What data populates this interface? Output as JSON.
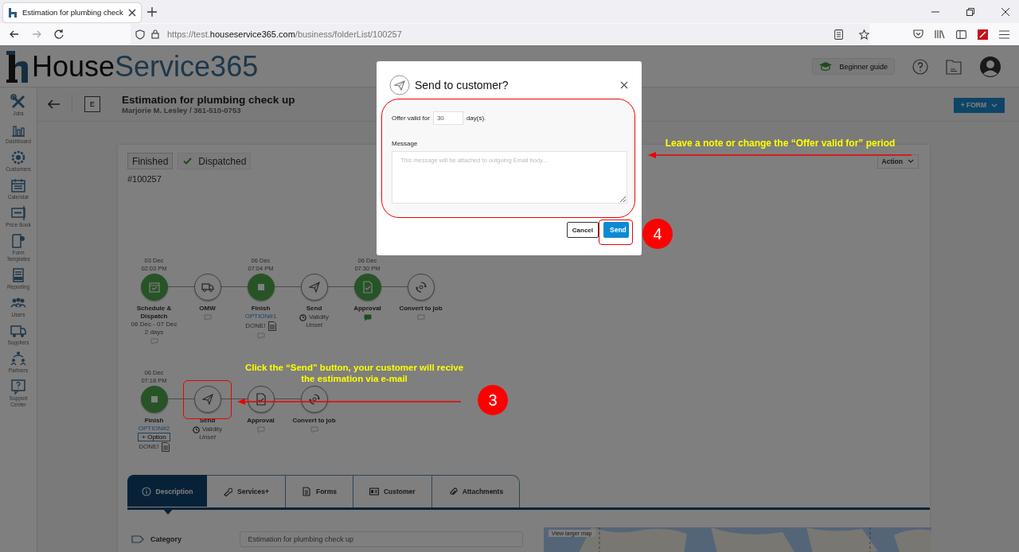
{
  "browser": {
    "tab_title": "Estimation for plumbing check",
    "url": {
      "scheme": "https://test.",
      "domain": "houseservice365.com",
      "path": "/business/folderList/100257"
    }
  },
  "header": {
    "logo_dark": "House",
    "logo_blue": "Service365",
    "guide_button": "Beginner guide"
  },
  "sidebar": {
    "items": [
      {
        "kind": "jobs",
        "label": "Jobs"
      },
      {
        "kind": "dashboard",
        "label": "Dashboard"
      },
      {
        "kind": "customers",
        "label": "Customers"
      },
      {
        "kind": "calendar",
        "label": "Calendar"
      },
      {
        "kind": "pricebook",
        "label": "Price Book"
      },
      {
        "kind": "forms",
        "label": "Form Templates"
      },
      {
        "kind": "reporting",
        "label": "Reporting"
      },
      {
        "kind": "users",
        "label": "Users"
      },
      {
        "kind": "suppliers",
        "label": "Suppliers"
      },
      {
        "kind": "partners",
        "label": "Partners"
      },
      {
        "kind": "support",
        "label": "Support Center"
      }
    ]
  },
  "title_bar": {
    "type_badge": "E",
    "title": "Estimation for plumbing check up",
    "subtitle": "Marjorie M. Lesley / 361-510-0753",
    "form_button": "+ FORM"
  },
  "card": {
    "statuses": [
      {
        "label": "Finished",
        "checked": false
      },
      {
        "label": "Dispatched",
        "checked": true
      }
    ],
    "number": "#100257",
    "action_button": "Action",
    "timeline_rows": [
      {
        "nodes": [
          {
            "kind": "schedule",
            "date": "03 Dec",
            "time": "02:03 PM",
            "label": "Schedule & Dispatch",
            "done": true,
            "details": [
              {
                "kind": "text",
                "text": "06 Dec - 07 Dec"
              },
              {
                "kind": "text",
                "text": "2 days"
              },
              {
                "kind": "comment",
                "highlighted": false
              }
            ]
          },
          {
            "kind": "omw",
            "label": "OMW",
            "done": false,
            "details": [
              {
                "kind": "comment",
                "highlighted": false
              }
            ]
          },
          {
            "kind": "finish",
            "date": "06 Dec",
            "time": "07:04 PM",
            "label": "Finish",
            "done": true,
            "details": [
              {
                "kind": "option",
                "text": "OPTION#1"
              },
              {
                "kind": "done",
                "text": "DONE!"
              },
              {
                "kind": "comment",
                "highlighted": false
              }
            ]
          },
          {
            "kind": "send",
            "label": "Send",
            "done": false,
            "details": [
              {
                "kind": "validity",
                "text": "Validity"
              },
              {
                "kind": "unset",
                "text": "Unset"
              }
            ]
          },
          {
            "kind": "approval",
            "date": "06 Dec",
            "time": "07:30 PM",
            "label": "Approval",
            "done": true,
            "details": [
              {
                "kind": "comment",
                "highlighted": true
              }
            ]
          },
          {
            "kind": "convert",
            "label": "Convert to job",
            "done": false,
            "details": [
              {
                "kind": "comment",
                "highlighted": false
              }
            ]
          }
        ]
      },
      {
        "nodes": [
          {
            "kind": "finish",
            "date": "06 Dec",
            "time": "07:18 PM",
            "label": "Finish",
            "done": true,
            "details": [
              {
                "kind": "option",
                "text": "OPTION#2"
              },
              {
                "kind": "add-option",
                "text": "+ Option"
              },
              {
                "kind": "done",
                "text": "DONE!"
              }
            ]
          },
          {
            "kind": "send",
            "label": "Send",
            "done": false,
            "details": [
              {
                "kind": "validity",
                "text": "Validity"
              },
              {
                "kind": "unset",
                "text": "Unset"
              }
            ]
          },
          {
            "kind": "approval",
            "label": "Approval",
            "done": false,
            "details": [
              {
                "kind": "comment",
                "highlighted": false
              }
            ]
          },
          {
            "kind": "convert",
            "label": "Convert to job",
            "done": false,
            "details": [
              {
                "kind": "comment",
                "highlighted": false
              }
            ]
          }
        ]
      }
    ],
    "tabs": [
      {
        "kind": "info",
        "label": "Description",
        "selected": true
      },
      {
        "kind": "wrench",
        "label": "Services+",
        "selected": false
      },
      {
        "kind": "doc",
        "label": "Forms",
        "selected": false
      },
      {
        "kind": "card",
        "label": "Customer",
        "selected": false
      },
      {
        "kind": "clip",
        "label": "Attachments",
        "selected": false
      }
    ],
    "category_label": "Category",
    "category_value": "Estimation for plumbing check up",
    "map": {
      "kind": "picture",
      "link": "View larger map"
    }
  },
  "modal": {
    "title": "Send to customer?",
    "offer_label": "Offer valid for",
    "offer_value": "30",
    "offer_unit": "day(s).",
    "message_label": "Message",
    "message_placeholder": "This message will be attached to outgoing Email body...",
    "cancel": "Cancel",
    "send": "Send"
  },
  "annotations": {
    "step_modal": "4",
    "note_modal": "Leave a note or change the “Offer valid for” period",
    "step_node": "3",
    "note_node": "Click the “Send” button, your customer will recive the estimation via e-mail"
  }
}
